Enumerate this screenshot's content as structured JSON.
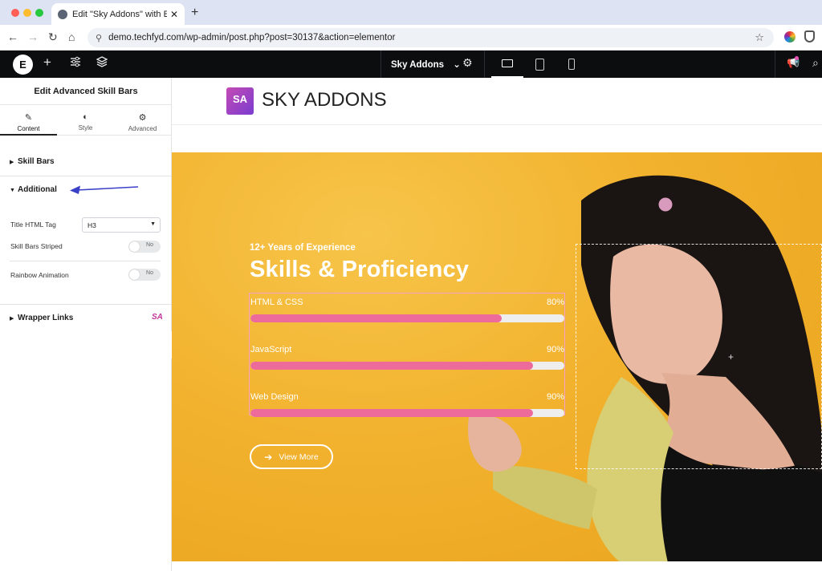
{
  "browser": {
    "tab_title": "Edit \"Sky Addons\" with Elem",
    "close_glyph": "✕",
    "new_tab_glyph": "+",
    "url": "demo.techfyd.com/wp-admin/post.php?post=30137&action=elementor",
    "traffic_colors": [
      "#ff5f57",
      "#febc2e",
      "#28c840"
    ]
  },
  "editor_bar": {
    "logo_glyph": "E",
    "page_name": "Sky Addons",
    "page_caret": "⌄",
    "add_icon": "+",
    "settings_icon": "⚙"
  },
  "panel": {
    "title": "Edit Advanced Skill Bars",
    "tabs": [
      {
        "label": "Content",
        "icon": "✎"
      },
      {
        "label": "Style",
        "icon": "◐"
      },
      {
        "label": "Advanced",
        "icon": "⚙"
      }
    ],
    "sections": {
      "skill_bars": "Skill Bars",
      "additional": "Additional",
      "wrapper_links": "Wrapper Links"
    },
    "controls": {
      "title_tag_label": "Title HTML Tag",
      "title_tag_value": "H3",
      "striped_label": "Skill Bars Striped",
      "striped_value": "No",
      "rainbow_label": "Rainbow Animation",
      "rainbow_value": "No"
    },
    "wrapper_badge": "SA",
    "collapse_glyph": "‹"
  },
  "canvas": {
    "brand_logo": "SA",
    "brand_name": "SKY ADDONS",
    "hero": {
      "subtitle": "12+ Years of Experience",
      "heading": "Skills & Proficiency",
      "skills": [
        {
          "name": "HTML & CSS",
          "pct_label": "80%",
          "value": 80
        },
        {
          "name": "JavaScript",
          "pct_label": "90%",
          "value": 90
        },
        {
          "name": "Web Design",
          "pct_label": "90%",
          "value": 90
        }
      ],
      "button_label": "View More",
      "button_arrow": "➔"
    }
  },
  "colors": {
    "accent_pink": "#ec6b9a",
    "hero_orange": "#f2b22e",
    "editor_dark": "#0c0d0e",
    "annotation_blue": "#3a3fc8"
  }
}
